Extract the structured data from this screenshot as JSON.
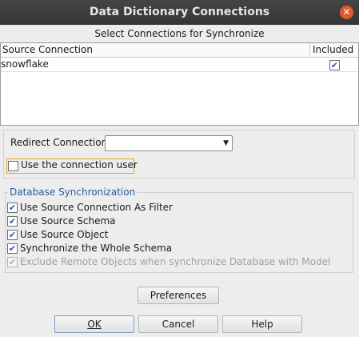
{
  "window": {
    "title": "Data Dictionary Connections",
    "close_glyph": "✕"
  },
  "subtitle": "Select Connections for Synchronize",
  "table": {
    "columns": [
      "Source Connection",
      "Included"
    ],
    "rows": [
      {
        "name": "snowflake",
        "included": true
      }
    ]
  },
  "redirect": {
    "label": "Redirect Connection",
    "value": "",
    "arrow": "▼"
  },
  "use_connection_user": {
    "label": "Use the connection user",
    "checked": false
  },
  "sync": {
    "legend": "Database Synchronization",
    "options": [
      {
        "label": "Use Source Connection As Filter",
        "checked": true,
        "enabled": true
      },
      {
        "label": "Use Source Schema",
        "checked": true,
        "enabled": true
      },
      {
        "label": "Use Source Object",
        "checked": true,
        "enabled": true
      },
      {
        "label": "Synchronize the Whole Schema",
        "checked": true,
        "enabled": true
      },
      {
        "label": "Exclude Remote Objects when synchronize Database with Model",
        "checked": true,
        "enabled": false
      }
    ]
  },
  "buttons": {
    "preferences": "Preferences",
    "ok": "OK",
    "cancel": "Cancel",
    "help": "Help"
  },
  "check_glyph": "✔",
  "colors": {
    "titlebar": "#3d3d3d",
    "close": "#e05a2b",
    "legend": "#2a5a98",
    "focus": "#e0a030"
  }
}
